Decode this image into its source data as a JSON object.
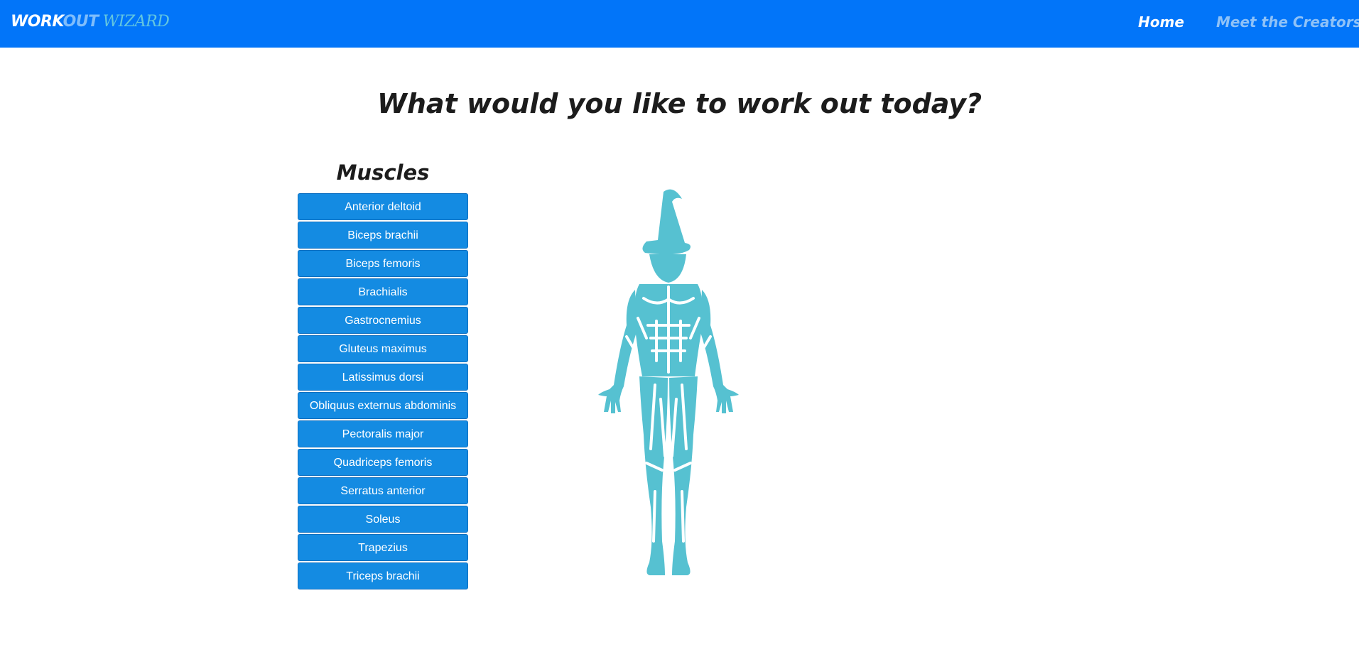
{
  "navbar": {
    "brand": {
      "part1": "WORK",
      "part2": "OUT",
      "part3": "WIZARD"
    },
    "links": {
      "home": "Home",
      "creators": "Meet the Creators"
    }
  },
  "main": {
    "headline": "What would you like to work out today?",
    "muscles_title": "Muscles",
    "muscles": [
      "Anterior deltoid",
      "Biceps brachii",
      "Biceps femoris",
      "Brachialis",
      "Gastrocnemius",
      "Gluteus maximus",
      "Latissimus dorsi",
      "Obliquus externus abdominis",
      "Pectoralis major",
      "Quadriceps femoris",
      "Serratus anterior",
      "Soleus",
      "Trapezius",
      "Triceps brachii"
    ]
  },
  "colors": {
    "navbar": "#0275f9",
    "button": "#148be2",
    "figure": "#56c1d1"
  },
  "icons": {
    "figure": "wizard-anatomy-figure"
  }
}
